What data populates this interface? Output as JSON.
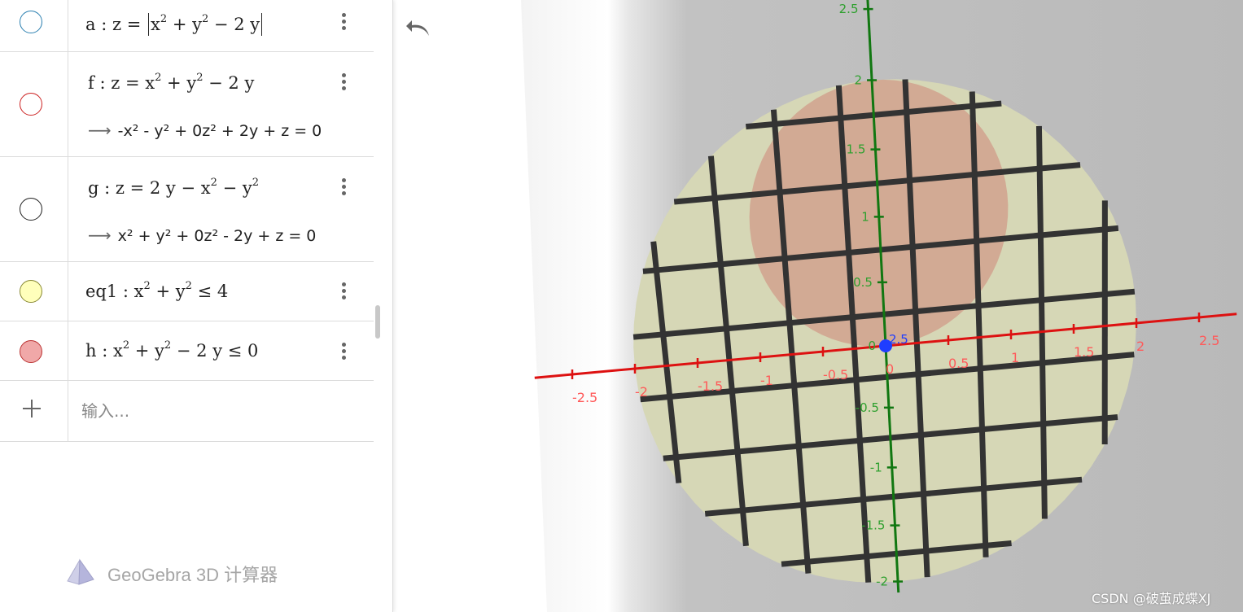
{
  "algebra": {
    "rows": [
      {
        "marble_color": "#2a7fb0",
        "marble_fill": "#ffffff",
        "name": "a",
        "parts": [
          "z =",
          "x",
          "2",
          "+ y",
          "2",
          "− 2 y"
        ]
      },
      {
        "marble_color": "#cc2222",
        "marble_fill": "#ffffff",
        "name": "f",
        "parts": [
          "z = x",
          "2",
          "+ y",
          "2",
          "− 2 y"
        ],
        "definition": "-x² - y² + 0z² + 2y + z = 0"
      },
      {
        "marble_color": "#222222",
        "marble_fill": "#ffffff",
        "name": "g",
        "parts": [
          "z = 2 y − x",
          "2",
          "− y",
          "2"
        ],
        "definition": "x² + y² + 0z² - 2y + z = 0"
      },
      {
        "marble_color": "#888833",
        "marble_fill": "#ffffbb",
        "name": "eq1",
        "parts": [
          "x",
          "2",
          "+ y",
          "2",
          "≤ 4"
        ]
      },
      {
        "marble_color": "#bb3333",
        "marble_fill": "#f0a8a8",
        "name": "h",
        "parts": [
          "x",
          "2",
          "+ y",
          "2",
          "− 2 y ≤ 0"
        ]
      }
    ],
    "input_placeholder": "输入...",
    "brand": "GeoGebra 3D 计算器"
  },
  "graphics": {
    "x_ticks": [
      "-2.5",
      "-2",
      "-1.5",
      "-1",
      "-0.5",
      "0",
      "0.5",
      "1",
      "1.5",
      "2",
      "2.5"
    ],
    "y_ticks": [
      "2.5",
      "2",
      "1.5",
      "1",
      "0.5",
      "0",
      "-0.5",
      "-1",
      "-1.5",
      "-2"
    ],
    "origin_label": "2.5",
    "colors": {
      "x_axis": "#dd1111",
      "y_axis": "#117711",
      "disk": "#d6d7b6",
      "region": "#d2a590",
      "point": "#1f3dff",
      "background": "#bdbdbd"
    }
  },
  "icons": {
    "undo": "undo-icon",
    "menu": "more-vert-icon",
    "add": "plus-icon",
    "logo": "geogebra-3d-logo-icon"
  },
  "watermark": "CSDN @破茧成蝶XJ"
}
